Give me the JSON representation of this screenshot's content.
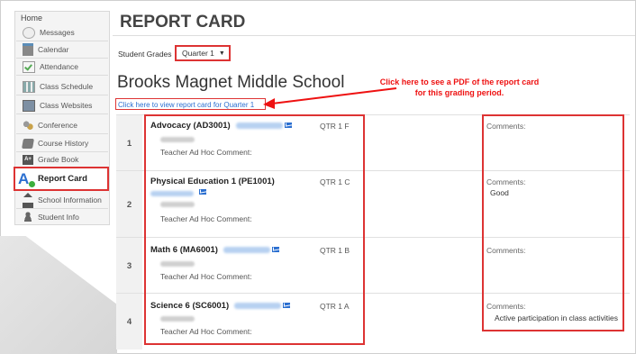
{
  "sidebar": {
    "home": "Home",
    "items": [
      {
        "label": "Messages",
        "icon": "messages-icon"
      },
      {
        "label": "Calendar",
        "icon": "calendar-icon"
      },
      {
        "label": "Attendance",
        "icon": "attendance-icon"
      },
      {
        "label": "Class Schedule",
        "icon": "schedule-icon"
      },
      {
        "label": "Class Websites",
        "icon": "websites-icon"
      },
      {
        "label": "Conference",
        "icon": "conference-icon"
      },
      {
        "label": "Course History",
        "icon": "history-icon"
      },
      {
        "label": "Grade Book",
        "icon": "gradebook-icon"
      },
      {
        "label": "Report Card",
        "icon": "report-card-icon",
        "active": true
      },
      {
        "label": "School Information",
        "icon": "school-icon"
      },
      {
        "label": "Student Info",
        "icon": "student-icon"
      }
    ]
  },
  "header": {
    "title": "REPORT CARD",
    "grades_label": "Student Grades",
    "quarter_value": "Quarter 1"
  },
  "school_name": "Brooks Magnet Middle School",
  "pdf_link": "Click here to view report card for Quarter 1",
  "annotation": "Click here to see a PDF of the report card for this grading period.",
  "colors": {
    "highlight": "#dd3333",
    "link": "#2b6fd0",
    "annotation": "#ee1111"
  },
  "courses": [
    {
      "num": "1",
      "name": "Advocacy (AD3001)",
      "grade": "QTR 1 F",
      "comments_label": "Comments:",
      "comment": "",
      "ahc": "Teacher Ad Hoc Comment:"
    },
    {
      "num": "2",
      "name": "Physical Education 1 (PE1001)",
      "grade": "QTR 1 C",
      "comments_label": "Comments:",
      "comment": "Good",
      "ahc": "Teacher Ad Hoc Comment:"
    },
    {
      "num": "3",
      "name": "Math 6 (MA6001)",
      "grade": "QTR 1 B",
      "comments_label": "Comments:",
      "comment": "",
      "ahc": "Teacher Ad Hoc Comment:"
    },
    {
      "num": "4",
      "name": "Science 6 (SC6001)",
      "grade": "QTR 1 A",
      "comments_label": "Comments:",
      "comment": "Active participation in class activities",
      "ahc": "Teacher Ad Hoc Comment:"
    }
  ]
}
